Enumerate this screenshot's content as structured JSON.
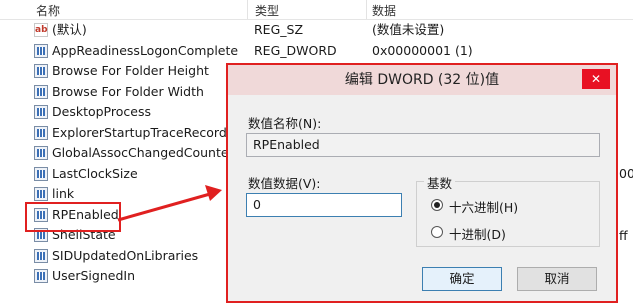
{
  "columns": {
    "name": "名称",
    "type": "类型",
    "data": "数据"
  },
  "rows": [
    {
      "name": "(默认)",
      "type": "REG_SZ",
      "data": "(数值未设置)",
      "icon": "string-value-icon"
    },
    {
      "name": "AppReadinessLogonComplete",
      "type": "REG_DWORD",
      "data": "0x00000001 (1)",
      "icon": "binary-value-icon"
    },
    {
      "name": "Browse For Folder Height",
      "type": "",
      "data": "",
      "icon": "binary-value-icon"
    },
    {
      "name": "Browse For Folder Width",
      "type": "",
      "data": "",
      "icon": "binary-value-icon"
    },
    {
      "name": "DesktopProcess",
      "type": "",
      "data": "",
      "icon": "binary-value-icon"
    },
    {
      "name": "ExplorerStartupTraceRecorded",
      "type": "",
      "data": "",
      "icon": "binary-value-icon"
    },
    {
      "name": "GlobalAssocChangedCounter",
      "type": "",
      "data": "",
      "icon": "binary-value-icon"
    },
    {
      "name": "LastClockSize",
      "type": "",
      "data": "",
      "icon": "binary-value-icon"
    },
    {
      "name": "link",
      "type": "",
      "data": "",
      "icon": "binary-value-icon"
    },
    {
      "name": "RPEnabled",
      "type": "",
      "data": "",
      "icon": "binary-value-icon"
    },
    {
      "name": "ShellState",
      "type": "",
      "data": "",
      "icon": "binary-value-icon"
    },
    {
      "name": "SIDUpdatedOnLibraries",
      "type": "",
      "data": "",
      "icon": "binary-value-icon"
    },
    {
      "name": "UserSignedIn",
      "type": "",
      "data": "",
      "icon": "binary-value-icon"
    }
  ],
  "right_edge_fragments": [
    "00",
    "ff"
  ],
  "dialog": {
    "title": "编辑 DWORD (32 位)值",
    "close_glyph": "✕",
    "value_name_label": "数值名称(N):",
    "value_name": "RPEnabled",
    "value_data_label": "数值数据(V):",
    "value_data": "0",
    "base_label": "基数",
    "hex_label": "十六进制(H)",
    "dec_label": "十进制(D)",
    "selected_base": "hex",
    "ok_label": "确定",
    "cancel_label": "取消"
  },
  "colors": {
    "highlight": "#e02020",
    "dialog_bg": "#f0f0f0",
    "title_bar": "#f0d9d9",
    "close": "#e81123"
  }
}
